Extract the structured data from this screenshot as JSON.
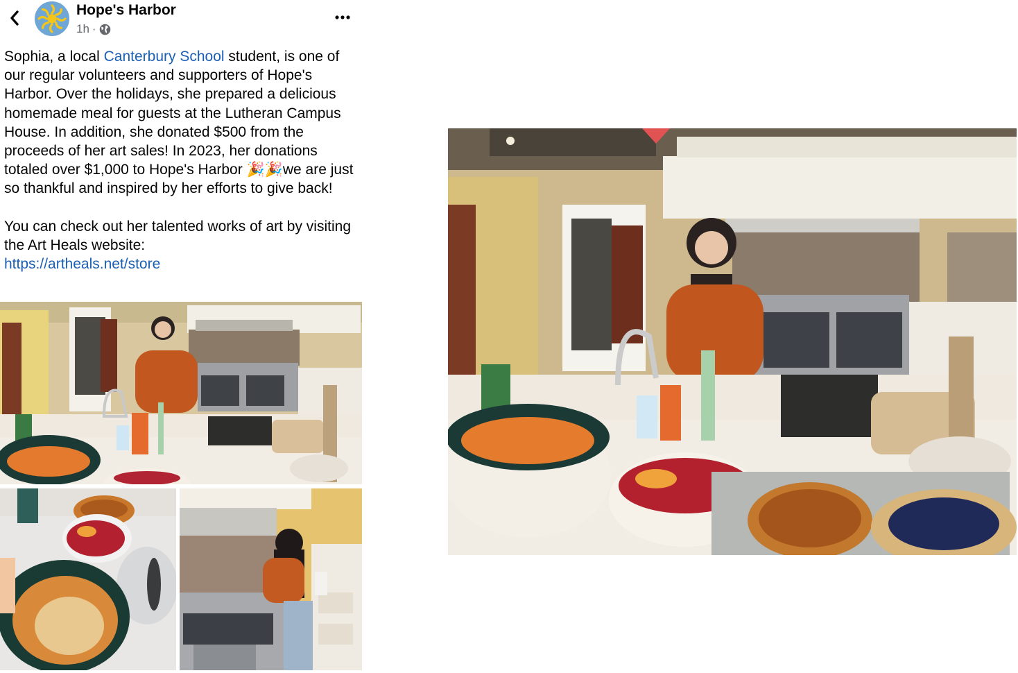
{
  "header": {
    "page_name": "Hope's Harbor",
    "time": "1h",
    "separator": "·",
    "back_icon": "chevron-left-icon",
    "more_icon": "more-horizontal-icon",
    "privacy_icon": "globe-icon"
  },
  "post": {
    "text_intro": "Sophia, a local ",
    "school_link": "Canterbury School",
    "text_main": " student, is one of our regular volunteers and supporters of Hope's Harbor. Over the holidays, she prepared a delicious homemade meal for guests at the Lutheran Campus House. In addition, she donated $500 from the proceeds of her art sales! In 2023, her donations totaled over $1,000 to Hope's Harbor ",
    "emoji": "🎉🎉",
    "text_end": "we are just so thankful and inspired by her efforts to give back!",
    "para2": "You can check out her talented works of art by visiting the Art Heals website:",
    "url": "https://artheals.net/store"
  },
  "colors": {
    "link": "#1a5fb4",
    "meta": "#65676b",
    "text": "#050505"
  }
}
